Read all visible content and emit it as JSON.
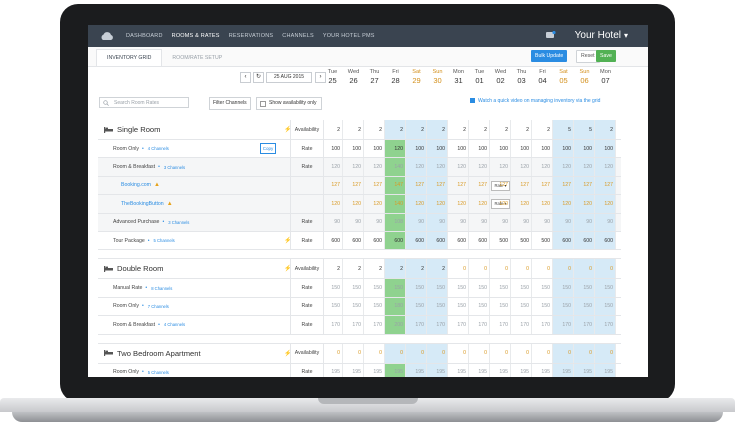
{
  "nav": {
    "links": [
      "DASHBOARD",
      "ROOMS & RATES",
      "RESERVATIONS",
      "CHANNELS",
      "YOUR HOTEL PMS"
    ],
    "active_index": 1,
    "hotel_name": "Your Hotel",
    "notif_count": "3"
  },
  "subnav": {
    "tabs": [
      "INVENTORY GRID",
      "ROOM/RATE SETUP"
    ],
    "bulk_update": "Bulk Update",
    "reset": "Reset",
    "save": "Save"
  },
  "datebar": {
    "date_value": "25 AUG 2015",
    "days": [
      {
        "name": "Tue",
        "num": "25",
        "weekend": false
      },
      {
        "name": "Wed",
        "num": "26",
        "weekend": false
      },
      {
        "name": "Thu",
        "num": "27",
        "weekend": false
      },
      {
        "name": "Fri",
        "num": "28",
        "weekend": false
      },
      {
        "name": "Sat",
        "num": "29",
        "weekend": true
      },
      {
        "name": "Sun",
        "num": "30",
        "weekend": true
      },
      {
        "name": "Mon",
        "num": "31",
        "weekend": false
      },
      {
        "name": "Tue",
        "num": "01",
        "weekend": false
      },
      {
        "name": "Wed",
        "num": "02",
        "weekend": false
      },
      {
        "name": "Thu",
        "num": "03",
        "weekend": false
      },
      {
        "name": "Fri",
        "num": "04",
        "weekend": false
      },
      {
        "name": "Sat",
        "num": "05",
        "weekend": true
      },
      {
        "name": "Sun",
        "num": "06",
        "weekend": true
      },
      {
        "name": "Mon",
        "num": "07",
        "weekend": false
      }
    ]
  },
  "filters": {
    "search_placeholder": "Search Room Rates",
    "filter_channels": "Filter Channels",
    "show_availability": "Show availability only",
    "video_link": "Watch a quick video on managing inventory via the grid"
  },
  "colors": {
    "accent": "#2a8ce2",
    "save": "#52b154",
    "nav_bg": "#3a4450",
    "highlight": "#d6eaf7",
    "selected": "#8fd28f",
    "weekend": "#d38f1a"
  },
  "grid": {
    "highlight_cols": [
      3,
      4,
      5,
      11,
      12,
      13
    ],
    "sel_col": 3,
    "rooms": [
      {
        "name": "Single Room",
        "availability_label": "Availability",
        "availability": [
          "2",
          "2",
          "2",
          "2",
          "2",
          "2",
          "2",
          "2",
          "2",
          "2",
          "2",
          "5",
          "5",
          "2"
        ],
        "avail_color": "dark",
        "rows": [
          {
            "label": "Room Only",
            "channels": "4 Channels",
            "type": "Rate",
            "copy": "Copy",
            "values": [
              "100",
              "100",
              "100",
              "120",
              "100",
              "100",
              "100",
              "100",
              "100",
              "100",
              "100",
              "100",
              "100",
              "100"
            ],
            "style": "dark",
            "kind": "sub"
          },
          {
            "label": "Room & Breakfast",
            "channels": "3 Channels",
            "type": "Rate",
            "values": [
              "120",
              "120",
              "120",
              "140",
              "120",
              "120",
              "120",
              "120",
              "120",
              "120",
              "120",
              "120",
              "120",
              "120"
            ],
            "style": "grey",
            "kind": "sub",
            "dim": true
          },
          {
            "label": "Booking.com",
            "type_select": "Rate",
            "values": [
              "127",
              "127",
              "127",
              "147",
              "127",
              "127",
              "127",
              "127",
              "127",
              "127",
              "127",
              "127",
              "127",
              "127"
            ],
            "style": "orange",
            "kind": "channel",
            "dim": true,
            "warn": true
          },
          {
            "label": "TheBookingButton",
            "type_select": "Rate",
            "values": [
              "120",
              "120",
              "120",
              "140",
              "120",
              "120",
              "120",
              "120",
              "120",
              "120",
              "120",
              "120",
              "120",
              "120"
            ],
            "style": "orange",
            "kind": "channel",
            "dim": true,
            "warn": true
          },
          {
            "label": "Advanced Purchase",
            "channels": "3 Channels",
            "type": "Rate",
            "values": [
              "90",
              "90",
              "90",
              "108",
              "90",
              "90",
              "90",
              "90",
              "90",
              "90",
              "90",
              "90",
              "90",
              "90"
            ],
            "style": "grey",
            "kind": "sub",
            "dim": true
          },
          {
            "label": "Tour Package",
            "channels": "5 Channels",
            "type": "Rate",
            "values": [
              "600",
              "600",
              "600",
              "600",
              "600",
              "600",
              "600",
              "600",
              "500",
              "500",
              "500",
              "600",
              "600",
              "600"
            ],
            "style": "dark",
            "kind": "sub"
          }
        ]
      },
      {
        "name": "Double Room",
        "availability_label": "Availability",
        "availability": [
          "2",
          "2",
          "2",
          "2",
          "2",
          "2",
          "0",
          "0",
          "0",
          "0",
          "0",
          "0",
          "0",
          "0"
        ],
        "avail_color": "mixed",
        "rows": [
          {
            "label": "Manual Rate",
            "channels": "8 Channels",
            "type": "Rate",
            "values": [
              "150",
              "150",
              "150",
              "150",
              "150",
              "150",
              "150",
              "150",
              "150",
              "150",
              "150",
              "150",
              "150",
              "150"
            ],
            "style": "grey",
            "kind": "sub"
          },
          {
            "label": "Room Only",
            "channels": "7 Channels",
            "type": "Rate",
            "values": [
              "150",
              "150",
              "150",
              "180",
              "150",
              "150",
              "150",
              "150",
              "150",
              "150",
              "150",
              "150",
              "150",
              "150"
            ],
            "style": "grey",
            "kind": "sub"
          },
          {
            "label": "Room & Breakfast",
            "channels": "4 Channels",
            "type": "Rate",
            "values": [
              "170",
              "170",
              "170",
              "200",
              "170",
              "170",
              "170",
              "170",
              "170",
              "170",
              "170",
              "170",
              "170",
              "170"
            ],
            "style": "grey",
            "kind": "sub"
          }
        ]
      },
      {
        "name": "Two Bedroom Apartment",
        "availability_label": "Availability",
        "availability": [
          "0",
          "0",
          "0",
          "0",
          "0",
          "0",
          "0",
          "0",
          "0",
          "0",
          "0",
          "0",
          "0",
          "0"
        ],
        "avail_color": "orange",
        "rows": [
          {
            "label": "Room Only",
            "channels": "5 Channels",
            "type": "Rate",
            "values": [
              "195",
              "195",
              "195",
              "195",
              "195",
              "195",
              "195",
              "195",
              "195",
              "195",
              "195",
              "195",
              "195",
              "195"
            ],
            "style": "grey",
            "kind": "sub"
          }
        ]
      }
    ]
  }
}
